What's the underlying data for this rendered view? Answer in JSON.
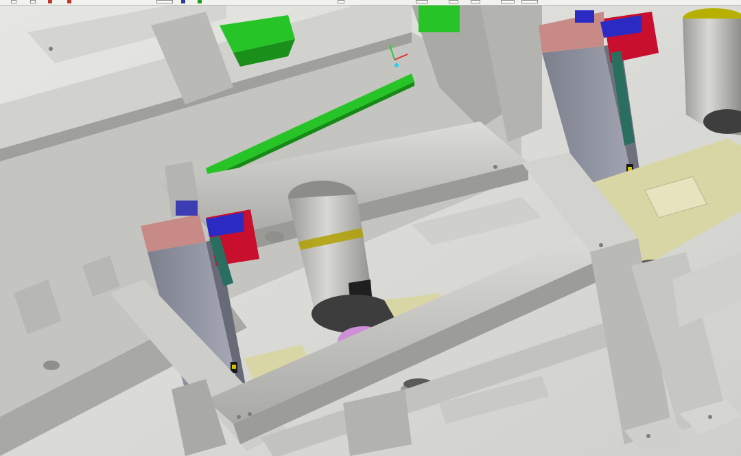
{
  "app": {
    "type": "3D CAD assembly viewport"
  },
  "toolbar": {
    "icons": [
      "tool-icon-1",
      "tool-icon-2",
      "tool-icon-3",
      "tool-icon-4",
      "view-icon",
      "view-icon-2",
      "view-icon-3",
      "view-icon-4",
      "view-icon-5"
    ],
    "accent_colors": [
      "#c0392b",
      "#2c3e9e",
      "#1f9d1f"
    ]
  },
  "viewport": {
    "colors": {
      "steel": "#c9c9c6",
      "steel_dark": "#9c9c99",
      "green_rail": "#27c427",
      "red_box": "#c8102e",
      "blue_box": "#2b2bc4",
      "pink_block": "#c88a86",
      "khaki_plate": "#d9d6a6",
      "magenta_part": "#cf8fd6",
      "dark_cylinder": "#4d4d4d",
      "yellow": "#b8b000"
    }
  }
}
